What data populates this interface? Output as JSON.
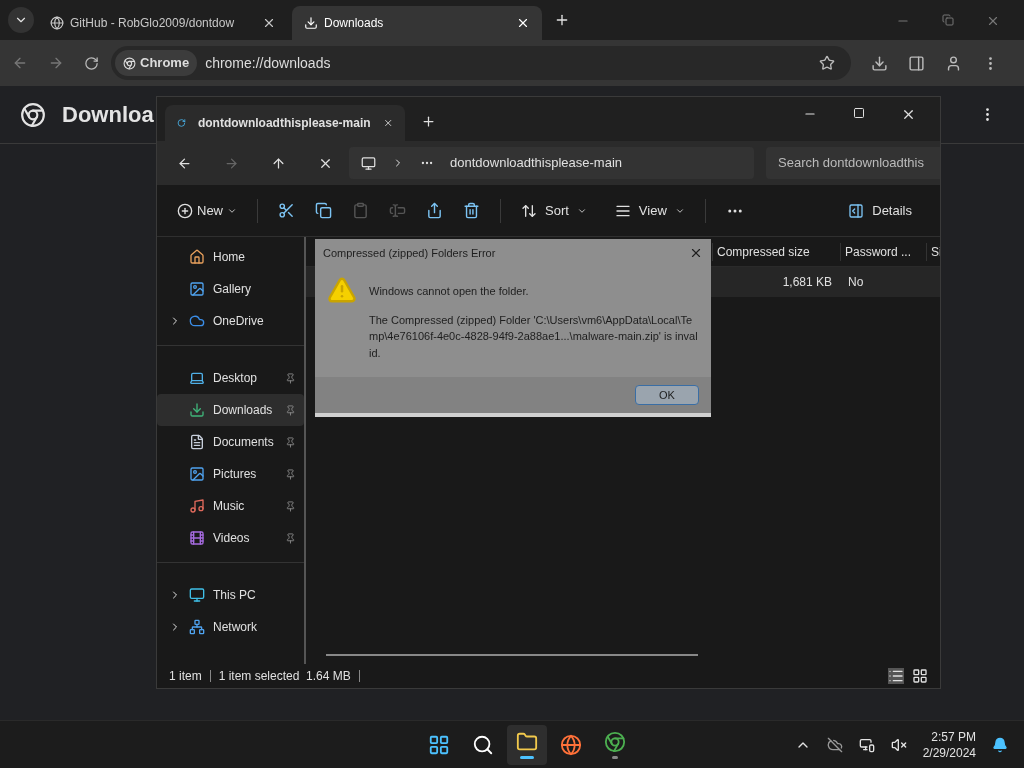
{
  "browser": {
    "tabs": [
      {
        "title": "GitHub - RobGlo2009/dontdow",
        "selected": false
      },
      {
        "title": "Downloads",
        "selected": true
      }
    ],
    "address": {
      "chip": "Chrome",
      "url": "chrome://downloads"
    },
    "page_title": "Downloa"
  },
  "explorer": {
    "tab": "dontdownloadthisplease-main",
    "breadcrumb": "dontdownloadthisplease-main",
    "search": {
      "placeholder": "Search dontdownloadthis"
    },
    "new_label": "New",
    "actions": [
      {
        "disabled": false
      },
      {
        "disabled": false
      },
      {
        "disabled": true
      },
      {
        "disabled": true
      },
      {
        "disabled": false
      },
      {
        "disabled": false
      }
    ],
    "sort_label": "Sort",
    "view_label": "View",
    "details_label": "Details",
    "sidebar": [
      [
        {
          "label": "Home",
          "expandable": false,
          "pinned": false,
          "selected": false
        },
        {
          "label": "Gallery",
          "expandable": false,
          "pinned": false,
          "selected": false
        },
        {
          "label": "OneDrive",
          "expandable": true,
          "pinned": false,
          "selected": false
        }
      ],
      [
        {
          "label": "Desktop",
          "expandable": false,
          "pinned": true,
          "selected": false
        },
        {
          "label": "Downloads",
          "expandable": false,
          "pinned": true,
          "selected": true
        },
        {
          "label": "Documents",
          "expandable": false,
          "pinned": true,
          "selected": false
        },
        {
          "label": "Pictures",
          "expandable": false,
          "pinned": true,
          "selected": false
        },
        {
          "label": "Music",
          "expandable": false,
          "pinned": true,
          "selected": false
        },
        {
          "label": "Videos",
          "expandable": false,
          "pinned": true,
          "selected": false
        }
      ],
      [
        {
          "label": "This PC",
          "expandable": true,
          "pinned": false,
          "selected": false
        },
        {
          "label": "Network",
          "expandable": true,
          "pinned": false,
          "selected": false
        }
      ]
    ],
    "columns": [
      "Compressed size",
      "Password ...",
      "Si"
    ],
    "rows": [
      {
        "cells": [
          "1,681 KB",
          "No"
        ],
        "selected": true
      }
    ],
    "status": {
      "count": "1 item",
      "selection": "1 item selected  1.64 MB"
    }
  },
  "dialog": {
    "title": "Compressed (zipped) Folders Error",
    "message": "Windows cannot open the folder.",
    "detail": "The Compressed (zipped) Folder 'C:\\Users\\vm6\\AppData\\Local\\Temp\\4e76106f-4e0c-4828-94f9-2a88ae1...\\malware-main.zip' is invalid.",
    "button": "OK"
  },
  "taskbar": {
    "apps": [
      {
        "active": false,
        "running": false
      },
      {
        "active": false,
        "running": false
      },
      {
        "active": true,
        "running": true
      },
      {
        "active": false,
        "running": false
      },
      {
        "active": false,
        "running": true
      }
    ],
    "time": "2:57 PM",
    "date": "2/29/2024"
  }
}
